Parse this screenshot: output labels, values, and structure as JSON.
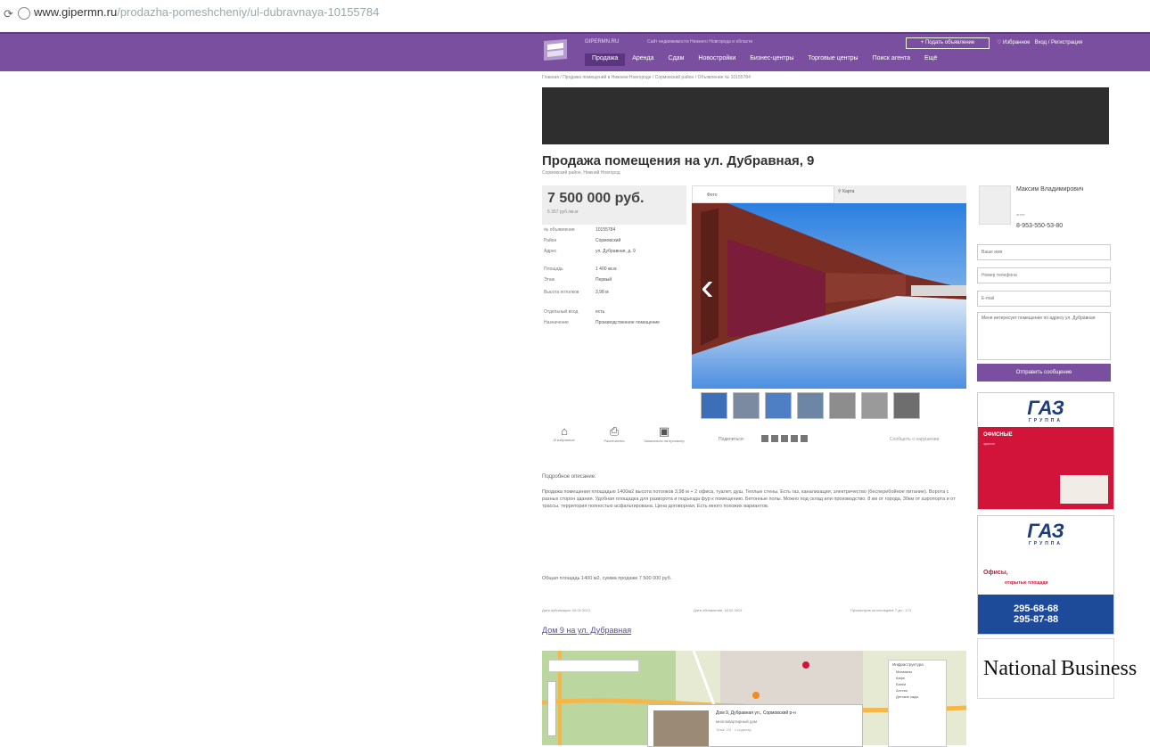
{
  "browser": {
    "url_host": "www.gipermn.ru",
    "url_path": "/prodazha-pomeshcheniy/ul-dubravnaya-10155784"
  },
  "header": {
    "brand": "GIPERMN.RU",
    "tagline": "Сайт недвижимости Нижнего Новгорода и области",
    "post_ad_label": "+ Подать объявление",
    "favorites_label": "♡ Избранное",
    "login_label": "Вход / Регистрация",
    "nav": [
      "Продажа",
      "Аренда",
      "Сдам",
      "Новостройки",
      "Бизнес-центры",
      "Торговые центры",
      "Поиск агента",
      "Ещё"
    ]
  },
  "breadcrumbs": "Главная / Продажа помещений в Нижнем Новгороде / Сормовский район / Объявление № 10155784",
  "listing": {
    "title": "Продажа помещения на ул. Дубравная, 9",
    "subtitle": "Сормовский район, Нижний Новгород",
    "price": "7 500 000 руб.",
    "price_per_m2": "5 357 руб./кв.м",
    "properties": [
      {
        "k": "№ объявления",
        "v": "10155784"
      },
      {
        "k": "Район",
        "v": "Сормовский"
      },
      {
        "k": "Адрес",
        "v": "ул. Дубравная, д. 9"
      },
      {
        "k": "Площадь",
        "v": "1 400 кв.м"
      },
      {
        "k": "Этаж",
        "v": "Первый"
      },
      {
        "k": "Высота потолков",
        "v": "3,98 м"
      },
      {
        "k": "Отдельный вход",
        "v": "есть"
      },
      {
        "k": "Назначение",
        "v": "Производственное помещение"
      }
    ],
    "gallery_tab_photo": "Фото",
    "gallery_tab_map": "Карта",
    "actions": [
      {
        "icon": "home-icon",
        "glyph": "⌂",
        "label": "В избранное"
      },
      {
        "icon": "print-icon",
        "glyph": "⎙",
        "label": "Распечатать"
      },
      {
        "icon": "calendar-icon",
        "glyph": "▣",
        "label": "Записаться на просмотр"
      }
    ],
    "share_label": "Поделиться:",
    "report_label": "Сообщить о нарушении",
    "description_heading": "Подробное описание:",
    "description": "Продажа помещения площадью 1400м2 высота потолков 3,98 м + 2 офиса, туалет, душ. Теплые стены. Есть газ, канализация, электричество (бесперебойное питание). Ворота с разных сторон здания. Удобная площадка для разворота и подъезда фур к помещению. Бетонные полы. Можно под склад или производство. 8 км от города, 30км от аэропорта и от трассы, территория полностью асфальтирована. Цена договорная. Есть много похожих вариантов.",
    "total": "Общая площадь 1400 м2, сумма продажи 7 500 000 руб.",
    "date_published": "Дата публикации: 04.02.2013",
    "date_updated": "Дата обновления: 18.02.2013",
    "views": "Просмотров за последние 7 дн.: 173",
    "house_link": "Дом 9 на ул. Дубравная",
    "map_popup_title": "Дом 9, Дубравная ул., Сормовский р-н",
    "map_popup_sub": "многоквартирный дом",
    "map_popup_sub2": "Этаж: 2/2 · 1 подъезд",
    "map_legend_title": "Инфраструктура",
    "map_legend": [
      "Магазины",
      "Кафе",
      "Банки",
      "Аптеки",
      "Детские сады"
    ]
  },
  "agent": {
    "name": "Максим Владимирович",
    "role": "агент",
    "phone": "8-953-550-53-80",
    "field_name_placeholder": "Ваше имя",
    "field_phone_placeholder": "Номер телефона",
    "field_email_placeholder": "E-mail",
    "message": "Меня интересует помещение по адресу ул. Дубравная",
    "send_label": "Отправить сообщение"
  },
  "ads": {
    "ad1_brand": "ГАЗ",
    "ad1_sub": "ГРУППА",
    "ad1_text": "ОФИСНЫЕ",
    "ad1_text2": "здания",
    "ad2_brand": "ГАЗ",
    "ad2_sub": "ГРУППА",
    "ad2_text": "Офисы,",
    "ad2_text2": "открытые площади",
    "ad2_phone1": "295-68-68",
    "ad2_phone2": "295-87-88",
    "ad3_word1": "National",
    "ad3_word2": "Business"
  },
  "colors": {
    "brand": "#7a4f9f",
    "link": "#5a4aa0",
    "ad_red": "#d2143a",
    "ad_blue": "#1e4a9a"
  }
}
